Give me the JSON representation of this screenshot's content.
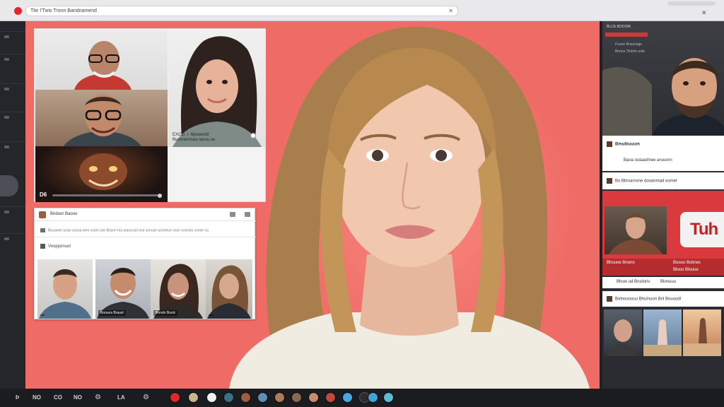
{
  "browser": {
    "url": "Tlie I'Twis Tronn Bandnamend",
    "close_glyph": "✕"
  },
  "toolbar_left": [
    {
      "label": "Þ"
    },
    {
      "label": "NO"
    },
    {
      "label": "CO"
    },
    {
      "label": "NO"
    },
    {
      "label": "LA"
    }
  ],
  "grid": {
    "tile4_caption_line1": "EXCO. I. Mpowerld",
    "tile4_caption_line2": "Buosrannnaa ianuu.ue",
    "tile3_badge": "D6"
  },
  "card": {
    "title": "Bnduor Baooo",
    "line1": "Buounee unao cuooa weo cnunl ooe Boyon ma unpcnunl ooe sonuse uoneeue cnon oooneo conne nu",
    "subheading": "Voopponuot",
    "participants": [
      {
        "caption": ""
      },
      {
        "caption": "Bnnuos Brauvt"
      },
      {
        "caption": "Bnndn Burnt"
      },
      {
        "caption": ""
      }
    ]
  },
  "sidebar": {
    "top_label": "BLUS BOOOM",
    "top_sub": "Fuooe Brauvioge",
    "top_sub2": "Bonns Thdmn unle",
    "card_a_title": "Bmulbuuum",
    "card_a_sub": "Baoa oulaadmee anuumn",
    "card_b_title": "Bo Bbnunnvne dooanmad oomel",
    "yt_text": "Tuh",
    "red_foot1": "Bhouoe Bnono",
    "red_foot2": "Boouo Bcbnec",
    "red_foot3": "Blooo Blouue",
    "card_c_title": "Bhuw ud Brudonv",
    "card_c_sub": "Blonuuu",
    "card_d_title": "Bolnouoouu Bhulnuon Bnl Bouuudl"
  },
  "colors": {
    "stage": "#ef6b66",
    "accent_red": "#e2262a",
    "yt_red": "#d83a3d"
  },
  "icons": [
    "record-icon",
    "close-icon",
    "gear-icon",
    "avatar-icons"
  ]
}
